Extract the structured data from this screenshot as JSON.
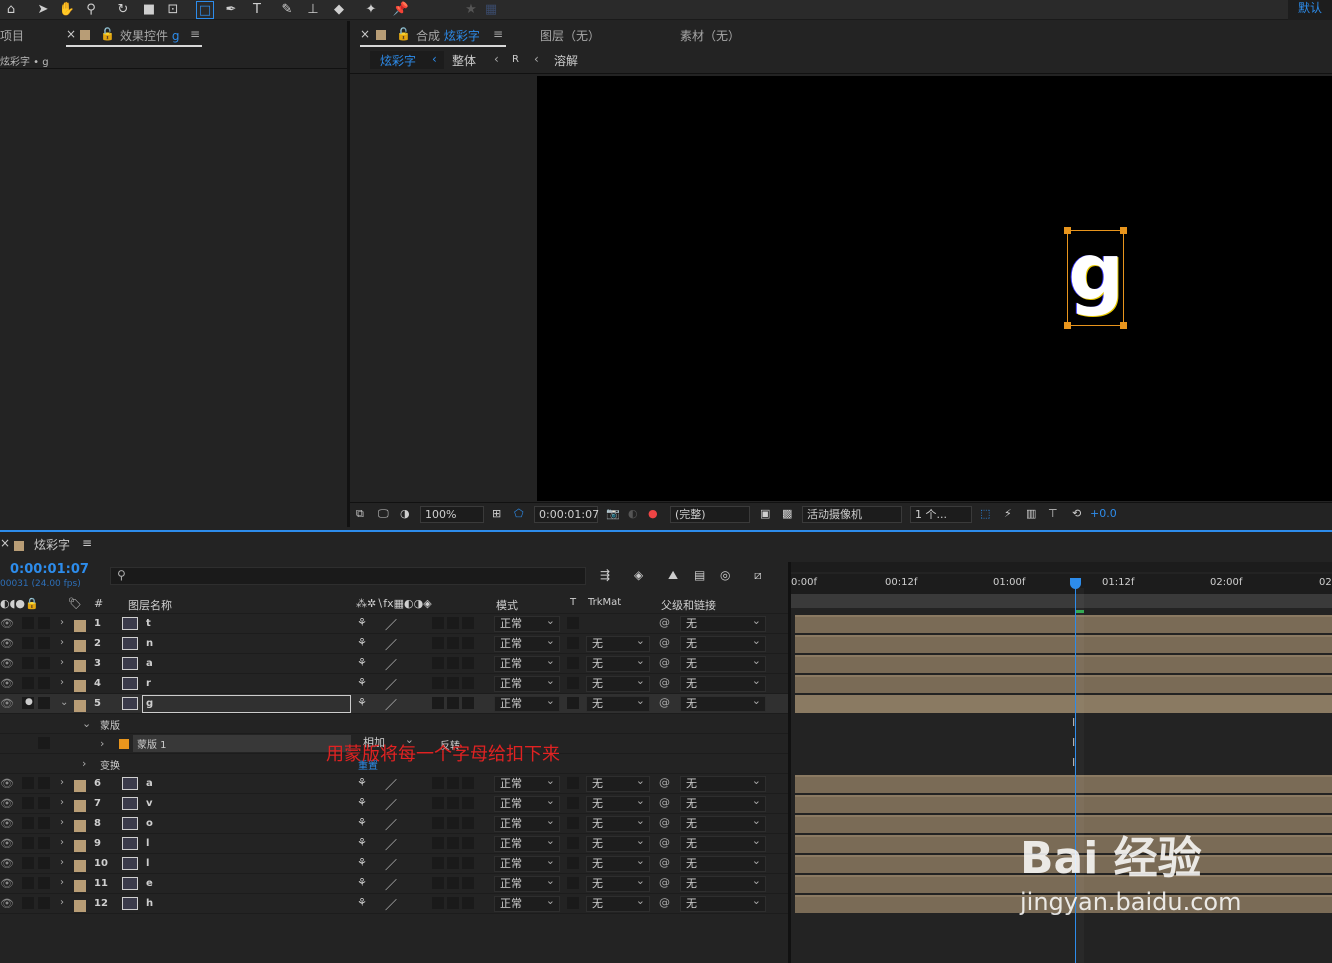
{
  "toolbar": {
    "workspace_label": "默认",
    "tools": [
      "home-icon",
      "selection-icon",
      "hand-icon",
      "zoom-icon",
      "rotate-icon",
      "camera-icon",
      "pan-behind-icon",
      "rectangle-icon",
      "pen-icon",
      "type-icon",
      "brush-icon",
      "stamp-icon",
      "eraser-icon",
      "roto-brush-icon",
      "puppet-pin-icon",
      "star-icon",
      "grid-icon"
    ]
  },
  "left_panel": {
    "tab_project": "项目",
    "tab_effects_prefix": "效果控件",
    "tab_effects_layer": "g",
    "breadcrumb": "炫彩字 • g"
  },
  "comp_panel": {
    "tab_comp_prefix": "合成",
    "tab_comp_name": "炫彩字",
    "tab_layer": "图层（无）",
    "tab_footage": "素材（无）",
    "nav": [
      "炫彩字",
      "整体",
      "R",
      "溶解"
    ],
    "letter": "g"
  },
  "viewer_footer": {
    "zoom": "100%",
    "timecode": "0:00:01:07",
    "resolution": "(完整)",
    "camera": "活动摄像机",
    "views": "1 个...",
    "exposure": "+0.0"
  },
  "timeline": {
    "comp_name": "炫彩字",
    "timecode": "0:00:01:07",
    "frame_info": "00031 (24.00 fps)",
    "search_placeholder": "",
    "columns": {
      "num": "#",
      "layer_name": "图层名称",
      "mode": "模式",
      "t": "T",
      "trkmat": "TrkMat",
      "parent": "父级和链接"
    },
    "ruler": [
      "0:00f",
      "00:12f",
      "01:00f",
      "01:12f",
      "02:00f",
      "02"
    ],
    "layers_top": [
      {
        "num": "1",
        "name": "t",
        "mode": "正常",
        "trkmat": "",
        "parent": "无"
      },
      {
        "num": "2",
        "name": "n",
        "mode": "正常",
        "trkmat": "无",
        "parent": "无"
      },
      {
        "num": "3",
        "name": "a",
        "mode": "正常",
        "trkmat": "无",
        "parent": "无"
      },
      {
        "num": "4",
        "name": "r",
        "mode": "正常",
        "trkmat": "无",
        "parent": "无"
      },
      {
        "num": "5",
        "name": "g",
        "mode": "正常",
        "trkmat": "无",
        "parent": "无"
      }
    ],
    "mask_group": "蒙版",
    "mask_name": "蒙版 1",
    "mask_mode": "相加",
    "mask_invert": "反转",
    "mask_reset": "重置",
    "transform_group": "变换",
    "layers_bottom": [
      {
        "num": "6",
        "name": "a",
        "mode": "正常",
        "trkmat": "无",
        "parent": "无"
      },
      {
        "num": "7",
        "name": "v",
        "mode": "正常",
        "trkmat": "无",
        "parent": "无"
      },
      {
        "num": "8",
        "name": "o",
        "mode": "正常",
        "trkmat": "无",
        "parent": "无"
      },
      {
        "num": "9",
        "name": "l",
        "mode": "正常",
        "trkmat": "无",
        "parent": "无"
      },
      {
        "num": "10",
        "name": "l",
        "mode": "正常",
        "trkmat": "无",
        "parent": "无"
      },
      {
        "num": "11",
        "name": "e",
        "mode": "正常",
        "trkmat": "无",
        "parent": "无"
      },
      {
        "num": "12",
        "name": "h",
        "mode": "正常",
        "trkmat": "无",
        "parent": "无"
      }
    ]
  },
  "annotation": "用蒙版将每一个字母给扣下来",
  "watermark": {
    "logo": "Bai 经验",
    "url": "jingyan.baidu.com"
  },
  "colors": {
    "accent": "#2d8ceb",
    "label": "#b89d76",
    "handle": "#e8951d",
    "annotation": "#e02222"
  }
}
